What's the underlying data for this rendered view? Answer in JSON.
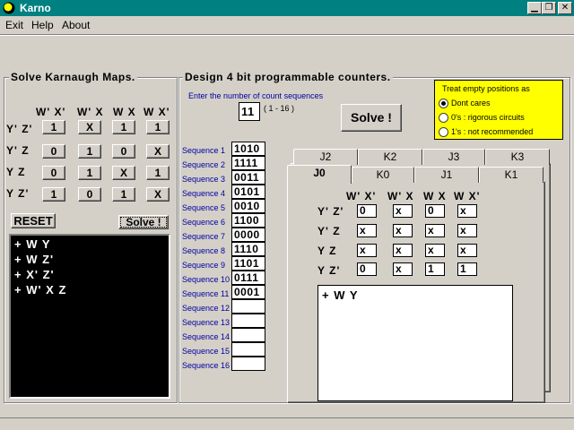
{
  "window": {
    "title": "Karno"
  },
  "menu": {
    "items": [
      "Exit",
      "Help",
      "About"
    ]
  },
  "solver": {
    "title": "Solve Karnaugh Maps.",
    "col_headers": [
      "W' X'",
      "W' X",
      "W X",
      "W X'"
    ],
    "row_headers": [
      "Y' Z'",
      "Y' Z",
      "Y Z",
      "Y Z'"
    ],
    "cells": [
      [
        "1",
        "X",
        "1",
        "1"
      ],
      [
        "0",
        "1",
        "0",
        "X"
      ],
      [
        "0",
        "1",
        "X",
        "1"
      ],
      [
        "1",
        "0",
        "1",
        "X"
      ]
    ],
    "reset_label": "RESET",
    "solve_label": "Solve !",
    "output": [
      "+ W  Y",
      "+ W  Z'",
      "+ X'  Z'",
      "+ W' X  Z"
    ]
  },
  "counter": {
    "title": "Design 4 bit programmable counters.",
    "count_prompt": "Enter the number of count sequences",
    "count_value": "11",
    "count_range": "( 1 - 16 )",
    "solve_label": "Solve !",
    "sequences": [
      {
        "label": "Sequence 1",
        "value": "1010"
      },
      {
        "label": "Sequence 2",
        "value": "1111"
      },
      {
        "label": "Sequence 3",
        "value": "0011"
      },
      {
        "label": "Sequence 4",
        "value": "0101"
      },
      {
        "label": "Sequence 5",
        "value": "0010"
      },
      {
        "label": "Sequence 6",
        "value": "1100"
      },
      {
        "label": "Sequence 7",
        "value": "0000"
      },
      {
        "label": "Sequence 8",
        "value": "1110"
      },
      {
        "label": "Sequence 9",
        "value": "1101"
      },
      {
        "label": "Sequence 10",
        "value": "0111"
      },
      {
        "label": "Sequence 11",
        "value": "0001"
      },
      {
        "label": "Sequence 12",
        "value": ""
      },
      {
        "label": "Sequence 13",
        "value": ""
      },
      {
        "label": "Sequence 14",
        "value": ""
      },
      {
        "label": "Sequence 15",
        "value": ""
      },
      {
        "label": "Sequence 16",
        "value": ""
      }
    ]
  },
  "empty_options": {
    "title": "Treat empty positions as",
    "options": [
      "Dont cares",
      "0's : rigorous circuits",
      "1's : not recommended"
    ],
    "selected": 0,
    "color": "#ffff00"
  },
  "tabs": {
    "back_row": [
      "J2",
      "K2",
      "J3",
      "K3"
    ],
    "front_row": [
      "J0",
      "K0",
      "J1",
      "K1"
    ],
    "active": "J0",
    "col_headers": [
      "W' X'",
      "W' X",
      "W X",
      "W X'"
    ],
    "row_headers": [
      "Y' Z'",
      "Y' Z",
      "Y Z",
      "Y Z'"
    ],
    "cells": [
      [
        "0",
        "x",
        "0",
        "x"
      ],
      [
        "x",
        "x",
        "x",
        "x"
      ],
      [
        "x",
        "x",
        "x",
        "x"
      ],
      [
        "0",
        "x",
        "1",
        "1"
      ]
    ],
    "result": "+ W  Y"
  },
  "colors": {
    "titlebar": "#008080",
    "face": "#d4d0c8",
    "sequence_label": "#0000a0"
  }
}
